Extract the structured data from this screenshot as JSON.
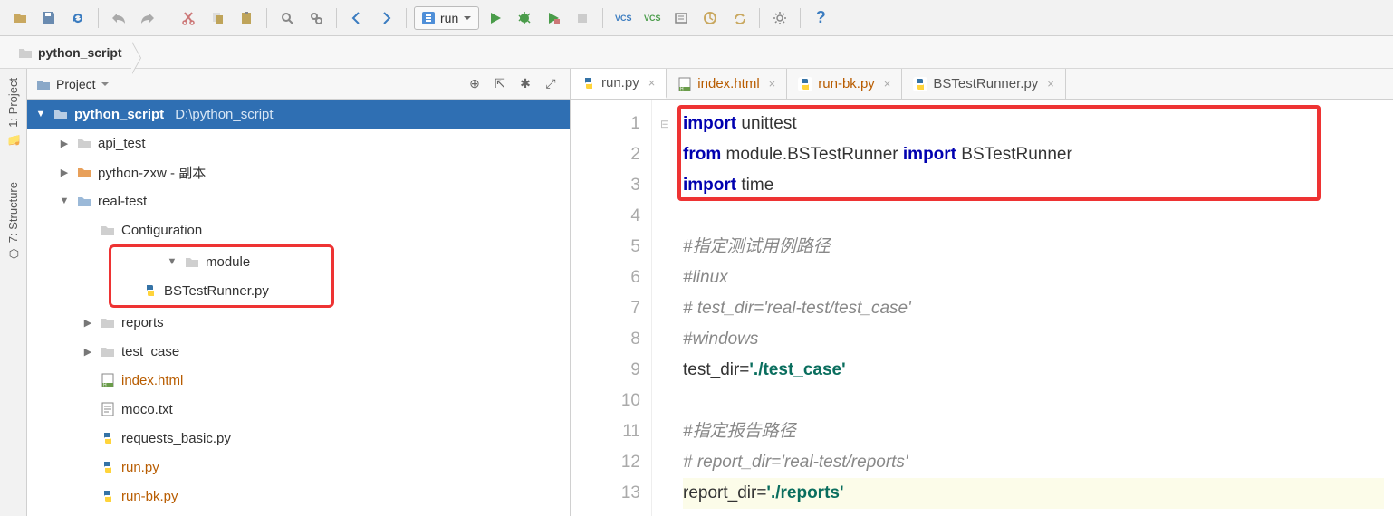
{
  "toolbar": {
    "run_config": "run"
  },
  "breadcrumb": {
    "root": "python_script"
  },
  "leftrail": {
    "project": "1: Project",
    "structure": "7: Structure"
  },
  "project_panel": {
    "title": "Project",
    "root": {
      "name": "python_script",
      "path": "D:\\python_script"
    },
    "items": [
      {
        "name": "api_test",
        "type": "folder",
        "indent": 1,
        "arrow": "▶"
      },
      {
        "name": "python-zxw - 副本",
        "type": "folder-orange",
        "indent": 1,
        "arrow": "▶"
      },
      {
        "name": "real-test",
        "type": "folder-blue",
        "indent": 1,
        "arrow": "▼"
      },
      {
        "name": "Configuration",
        "type": "folder",
        "indent": 2,
        "arrow": ""
      },
      {
        "name": "module",
        "type": "folder",
        "indent": 2,
        "arrow": "▼",
        "boxed": true
      },
      {
        "name": "BSTestRunner.py",
        "type": "py",
        "indent": 3,
        "arrow": "",
        "boxed": true
      },
      {
        "name": "reports",
        "type": "folder",
        "indent": 2,
        "arrow": "▶"
      },
      {
        "name": "test_case",
        "type": "folder",
        "indent": 2,
        "arrow": "▶"
      },
      {
        "name": "index.html",
        "type": "html",
        "indent": 2,
        "arrow": "",
        "orange": true
      },
      {
        "name": "moco.txt",
        "type": "txt",
        "indent": 2,
        "arrow": ""
      },
      {
        "name": "requests_basic.py",
        "type": "py",
        "indent": 2,
        "arrow": ""
      },
      {
        "name": "run.py",
        "type": "py",
        "indent": 2,
        "arrow": "",
        "orange": true
      },
      {
        "name": "run-bk.py",
        "type": "py",
        "indent": 2,
        "arrow": "",
        "orange": true
      }
    ]
  },
  "tabs": [
    {
      "name": "run.py",
      "type": "py",
      "active": true
    },
    {
      "name": "index.html",
      "type": "html",
      "orange": true
    },
    {
      "name": "run-bk.py",
      "type": "py",
      "orange": true
    },
    {
      "name": "BSTestRunner.py",
      "type": "py"
    }
  ],
  "code": {
    "lines": [
      {
        "n": 1,
        "html": "<span class='kw'>import</span> unittest"
      },
      {
        "n": 2,
        "html": "<span class='kw'>from</span> module.BSTestRunner <span class='kw'>import</span> BSTestRunner"
      },
      {
        "n": 3,
        "html": "<span class='kw'>import</span> time"
      },
      {
        "n": 4,
        "html": ""
      },
      {
        "n": 5,
        "html": "<span class='cm'>#指定测试用例路径</span>"
      },
      {
        "n": 6,
        "html": "<span class='cm'>#linux</span>"
      },
      {
        "n": 7,
        "html": "<span class='cm'># test_dir='real-test/test_case'</span>"
      },
      {
        "n": 8,
        "html": "<span class='cm'>#windows</span>"
      },
      {
        "n": 9,
        "html": "test_dir=<span class='str'>'./test_case'</span>"
      },
      {
        "n": 10,
        "html": ""
      },
      {
        "n": 11,
        "html": "<span class='cm'>#指定报告路径</span>"
      },
      {
        "n": 12,
        "html": "<span class='cm'># report_dir='real-test/reports'</span>"
      },
      {
        "n": 13,
        "html": "report_dir=<span class='str'>'./reports'</span>",
        "cur": true
      }
    ]
  }
}
